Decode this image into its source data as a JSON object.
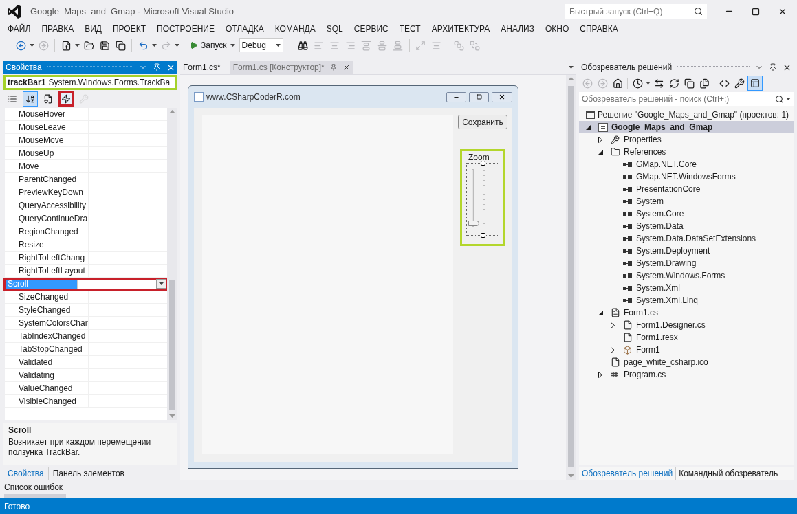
{
  "window": {
    "title": "Google_Maps_and_Gmap - Microsoft Visual Studio",
    "quick_launch_placeholder": "Быстрый запуск (Ctrl+Q)"
  },
  "menu": [
    "ФАЙЛ",
    "ПРАВКА",
    "ВИД",
    "ПРОЕКТ",
    "ПОСТРОЕНИЕ",
    "ОТЛАДКА",
    "КОМАНДА",
    "SQL",
    "СЕРВИС",
    "ТЕСТ",
    "АРХИТЕКТУРА",
    "АНАЛИЗ",
    "ОКНО",
    "СПРАВКА"
  ],
  "toolbar": {
    "run_label": "Запуск",
    "config_value": "Debug"
  },
  "properties": {
    "title": "Свойства",
    "object_name": "trackBar1",
    "object_type": "System.Windows.Forms.TrackBa",
    "view_buttons": [
      {
        "kind": "categorized",
        "selected": false,
        "disabled": false
      },
      {
        "kind": "alphabetical",
        "selected": true,
        "disabled": false
      },
      {
        "kind": "properties",
        "selected": false,
        "disabled": false
      },
      {
        "kind": "events",
        "selected": true,
        "disabled": false
      },
      {
        "kind": "property-pages",
        "selected": false,
        "disabled": true
      }
    ],
    "events": [
      {
        "name": "MouseHover",
        "selected": false
      },
      {
        "name": "MouseLeave",
        "selected": false
      },
      {
        "name": "MouseMove",
        "selected": false
      },
      {
        "name": "MouseUp",
        "selected": false
      },
      {
        "name": "Move",
        "selected": false
      },
      {
        "name": "ParentChanged",
        "selected": false
      },
      {
        "name": "PreviewKeyDown",
        "selected": false
      },
      {
        "name": "QueryAccessibility",
        "selected": false
      },
      {
        "name": "QueryContinueDra",
        "selected": false
      },
      {
        "name": "RegionChanged",
        "selected": false
      },
      {
        "name": "Resize",
        "selected": false
      },
      {
        "name": "RightToLeftChang",
        "selected": false
      },
      {
        "name": "RightToLeftLayout",
        "selected": false
      },
      {
        "name": "Scroll",
        "selected": true
      },
      {
        "name": "SizeChanged",
        "selected": false
      },
      {
        "name": "StyleChanged",
        "selected": false
      },
      {
        "name": "SystemColorsChar",
        "selected": false
      },
      {
        "name": "TabIndexChanged",
        "selected": false
      },
      {
        "name": "TabStopChanged",
        "selected": false
      },
      {
        "name": "Validated",
        "selected": false
      },
      {
        "name": "Validating",
        "selected": false
      },
      {
        "name": "ValueChanged",
        "selected": false
      },
      {
        "name": "VisibleChanged",
        "selected": false
      }
    ],
    "description_title": "Scroll",
    "description_text": "Возникает при каждом перемещении ползунка TrackBar.",
    "tabs": [
      {
        "label": "Свойства",
        "selected": true
      },
      {
        "label": "Панель элементов",
        "selected": false
      }
    ]
  },
  "editor_tabs": [
    {
      "label": "Form1.cs*",
      "selected": false
    },
    {
      "label": "Form1.cs [Конструктор]*",
      "selected": true
    }
  ],
  "form": {
    "title": "www.CSharpCoderR.com",
    "button": "Сохранить",
    "trackbar_label": "Zoom",
    "level": 0.05
  },
  "solution": {
    "title": "Обозреватель решений",
    "search_placeholder": "Обозреватель решений - поиск (Ctrl+;)",
    "root": "Решение \"Google_Maps_and_Gmap\"  (проектов: 1)",
    "tree": [
      {
        "label": "Google_Maps_and_Gmap",
        "kind": "project",
        "expanded": true,
        "selected": true,
        "children": [
          {
            "label": "Properties",
            "kind": "wrench",
            "expanded": false,
            "selected": false
          },
          {
            "label": "References",
            "kind": "folder",
            "expanded": true,
            "selected": false,
            "children": [
              {
                "label": "GMap.NET.Core",
                "kind": "reference",
                "selected": false
              },
              {
                "label": "GMap.NET.WindowsForms",
                "kind": "reference",
                "selected": false
              },
              {
                "label": "PresentationCore",
                "kind": "reference",
                "selected": false
              },
              {
                "label": "System",
                "kind": "reference",
                "selected": false
              },
              {
                "label": "System.Core",
                "kind": "reference",
                "selected": false
              },
              {
                "label": "System.Data",
                "kind": "reference",
                "selected": false
              },
              {
                "label": "System.Data.DataSetExtensions",
                "kind": "reference",
                "selected": false
              },
              {
                "label": "System.Deployment",
                "kind": "reference",
                "selected": false
              },
              {
                "label": "System.Drawing",
                "kind": "reference",
                "selected": false
              },
              {
                "label": "System.Windows.Forms",
                "kind": "reference",
                "selected": false
              },
              {
                "label": "System.Xml",
                "kind": "reference",
                "selected": false
              },
              {
                "label": "System.Xml.Linq",
                "kind": "reference",
                "selected": false
              }
            ]
          },
          {
            "label": "Form1.cs",
            "kind": "form",
            "expanded": true,
            "selected": false,
            "children": [
              {
                "label": "Form1.Designer.cs",
                "kind": "designer",
                "expanded": false,
                "selected": false
              },
              {
                "label": "Form1.resx",
                "kind": "designer",
                "selected": false
              },
              {
                "label": "Form1",
                "kind": "class",
                "expanded": false,
                "selected": false
              }
            ]
          },
          {
            "label": "page_white_csharp.ico",
            "kind": "file",
            "selected": false
          },
          {
            "label": "Program.cs",
            "kind": "csharp",
            "expanded": false,
            "selected": false
          }
        ]
      }
    ],
    "tabs": [
      {
        "label": "Обозреватель решений",
        "selected": true
      },
      {
        "label": "Командный обозреватель",
        "selected": false
      }
    ]
  },
  "bottom_tab": "Список ошибок",
  "status": "Готово"
}
